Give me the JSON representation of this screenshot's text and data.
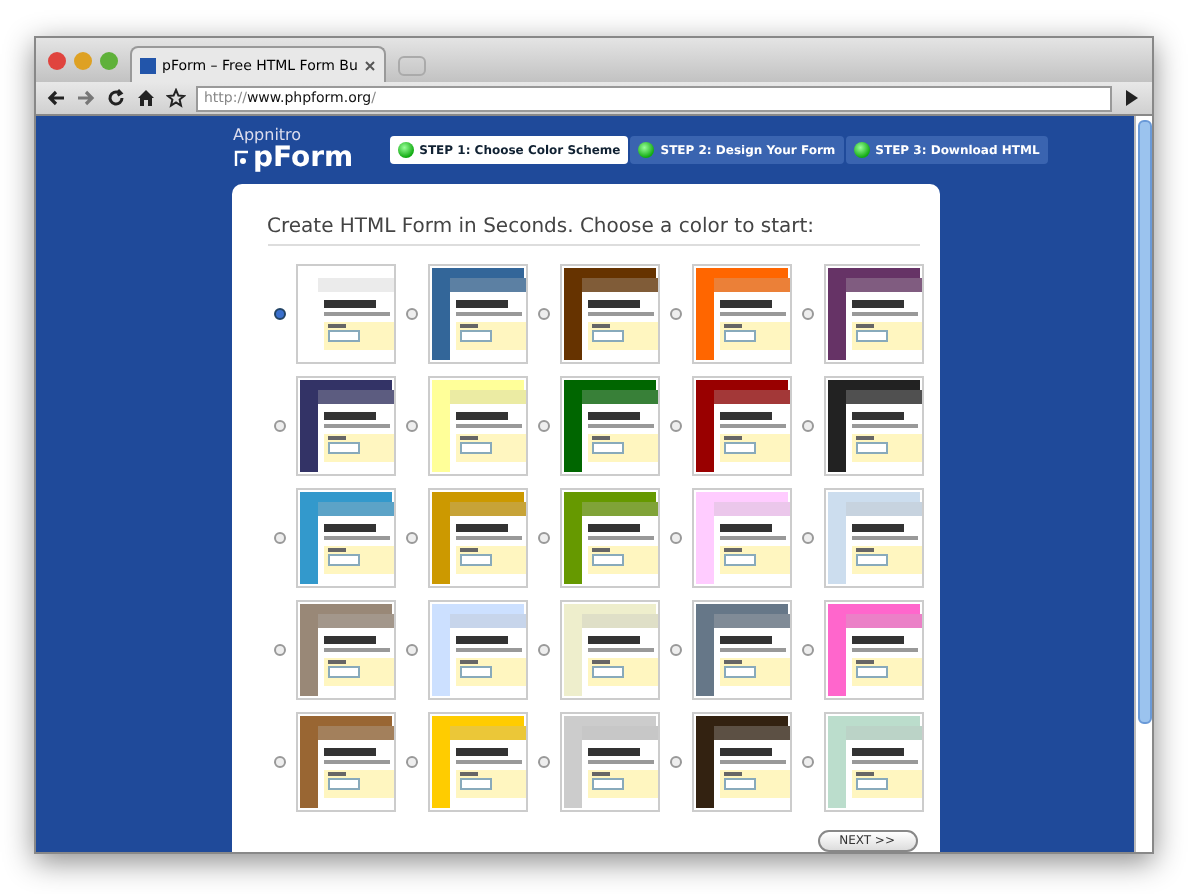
{
  "window": {
    "tab_title": "pForm – Free HTML Form Bu",
    "url_prefix": "http://",
    "url_host": "www.phpform.org",
    "url_suffix": "/"
  },
  "logo": {
    "small": "Appnitro",
    "big": "pForm"
  },
  "steps": [
    {
      "label": "STEP 1: Choose Color Scheme",
      "selected": true
    },
    {
      "label": "STEP 2: Design Your Form",
      "selected": false
    },
    {
      "label": "STEP 3: Download HTML",
      "selected": false
    }
  ],
  "heading": "Create HTML Form in Seconds. Choose a color to start:",
  "schemes": [
    {
      "selected": true,
      "color": "#ffffff"
    },
    {
      "selected": false,
      "color": "#336699"
    },
    {
      "selected": false,
      "color": "#663300"
    },
    {
      "selected": false,
      "color": "#ff6600"
    },
    {
      "selected": false,
      "color": "#663366"
    },
    {
      "selected": false,
      "color": "#333366"
    },
    {
      "selected": false,
      "color": "#ffff99"
    },
    {
      "selected": false,
      "color": "#006600"
    },
    {
      "selected": false,
      "color": "#990000"
    },
    {
      "selected": false,
      "color": "#222222"
    },
    {
      "selected": false,
      "color": "#3399cc"
    },
    {
      "selected": false,
      "color": "#cc9900"
    },
    {
      "selected": false,
      "color": "#669900"
    },
    {
      "selected": false,
      "color": "#ffccff"
    },
    {
      "selected": false,
      "color": "#ccddee"
    },
    {
      "selected": false,
      "color": "#998877"
    },
    {
      "selected": false,
      "color": "#cce0ff"
    },
    {
      "selected": false,
      "color": "#eeeecc"
    },
    {
      "selected": false,
      "color": "#667788"
    },
    {
      "selected": false,
      "color": "#ff66cc"
    },
    {
      "selected": false,
      "color": "#996633"
    },
    {
      "selected": false,
      "color": "#ffcc00"
    },
    {
      "selected": false,
      "color": "#cccccc"
    },
    {
      "selected": false,
      "color": "#332211"
    },
    {
      "selected": false,
      "color": "#bbddcc"
    }
  ],
  "next_button": "NEXT >>"
}
